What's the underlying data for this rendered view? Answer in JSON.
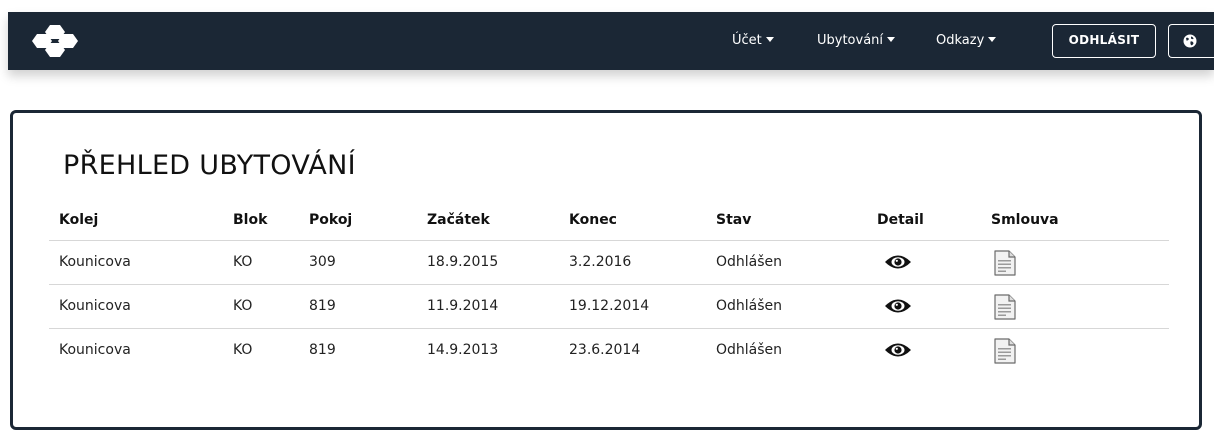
{
  "navbar": {
    "logo_icon": "honeycomb-logo",
    "menu": [
      {
        "label": "Účet"
      },
      {
        "label": "Ubytování"
      },
      {
        "label": "Odkazy"
      }
    ],
    "logout_label": "ODHLÁSIT",
    "language_icon": "globe-icon",
    "background": "#1b2735"
  },
  "main": {
    "title": "PŘEHLED UBYTOVÁNÍ",
    "columns": [
      "Kolej",
      "Blok",
      "Pokoj",
      "Začátek",
      "Konec",
      "Stav",
      "Detail",
      "Smlouva"
    ],
    "rows": [
      {
        "kolej": "Kounicova",
        "blok": "KO",
        "pokoj": "309",
        "zacatek": "18.9.2015",
        "konec": "3.2.2016",
        "stav": "Odhlášen",
        "detail_icon": "eye-icon",
        "smlouva_icon": "document-icon"
      },
      {
        "kolej": "Kounicova",
        "blok": "KO",
        "pokoj": "819",
        "zacatek": "11.9.2014",
        "konec": "19.12.2014",
        "stav": "Odhlášen",
        "detail_icon": "eye-icon",
        "smlouva_icon": "document-icon"
      },
      {
        "kolej": "Kounicova",
        "blok": "KO",
        "pokoj": "819",
        "zacatek": "14.9.2013",
        "konec": "23.6.2014",
        "stav": "Odhlášen",
        "detail_icon": "eye-icon",
        "smlouva_icon": "document-icon"
      }
    ]
  }
}
